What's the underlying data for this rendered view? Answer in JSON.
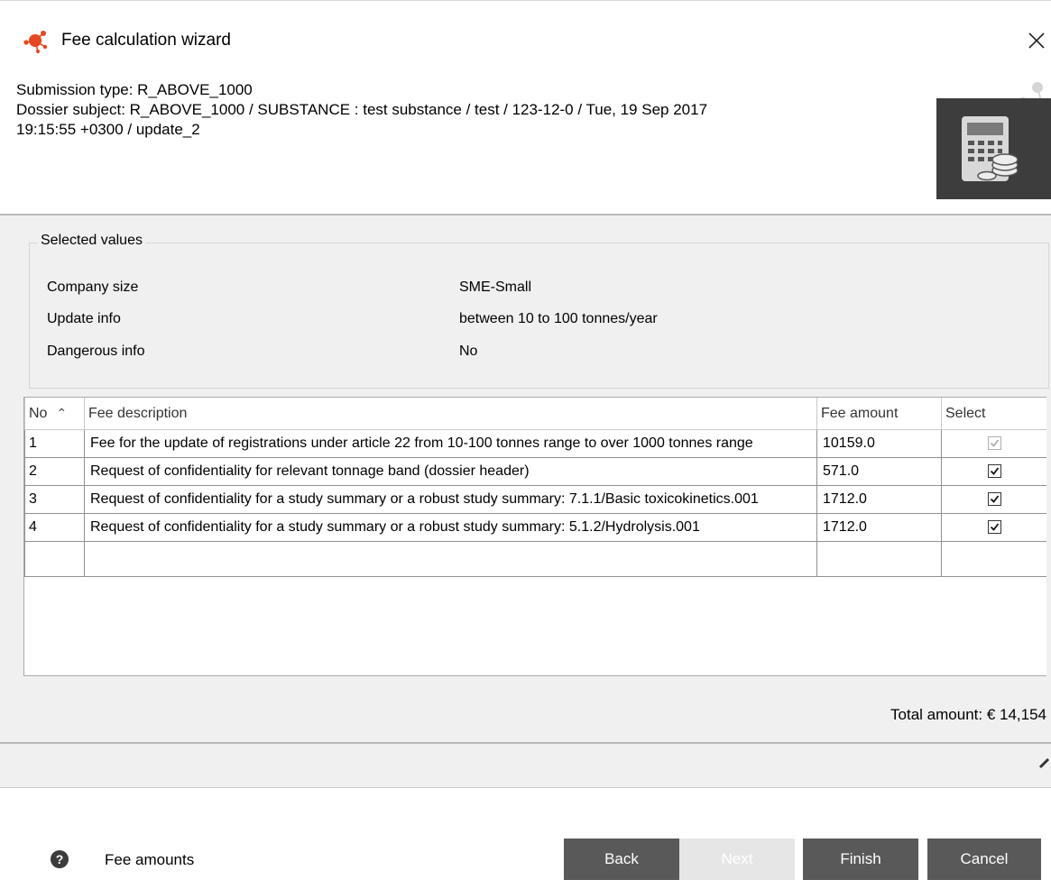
{
  "window": {
    "title": "Fee calculation wizard",
    "close_icon": "close-icon"
  },
  "header": {
    "submission_type": "Submission type: R_ABOVE_1000",
    "dossier_line1": "Dossier subject: R_ABOVE_1000 / SUBSTANCE : test substance / test / 123-12-0 / Tue, 19 Sep 2017",
    "dossier_line2": "19:15:55 +0300 / update_2",
    "image_icon": "calculator-coins-icon"
  },
  "selected_values": {
    "legend": "Selected values",
    "rows": [
      {
        "label": "Company size",
        "value": "SME-Small"
      },
      {
        "label": "Update info",
        "value": "between 10 to 100 tonnes/year"
      },
      {
        "label": "Dangerous info",
        "value": "No"
      }
    ]
  },
  "fee_table": {
    "columns": {
      "no": "No",
      "description": "Fee description",
      "amount": "Fee amount",
      "select": "Select"
    },
    "sort_icon": "sort-ascending-icon",
    "rows": [
      {
        "no": "1",
        "description": "Fee for the update of registrations under article 22 from 10-100 tonnes range to over 1000 tonnes range",
        "amount": "10159.0",
        "selected": true,
        "enabled": false
      },
      {
        "no": "2",
        "description": "Request of confidentiality for relevant tonnage band (dossier header)",
        "amount": "571.0",
        "selected": true,
        "enabled": true
      },
      {
        "no": "3",
        "description": "Request of confidentiality for a study summary or a robust study summary: 7.1.1/Basic toxicokinetics.001",
        "amount": "1712.0",
        "selected": true,
        "enabled": true
      },
      {
        "no": "4",
        "description": "Request of confidentiality for a study summary or a robust study summary: 5.1.2/Hydrolysis.001",
        "amount": "1712.0",
        "selected": true,
        "enabled": true
      }
    ]
  },
  "total": {
    "text": "Total amount: € 14,154"
  },
  "footer": {
    "help_icon": "help-icon",
    "help_label": "Fee amounts",
    "buttons": {
      "back": "Back",
      "next": "Next",
      "finish": "Finish",
      "cancel": "Cancel"
    }
  }
}
